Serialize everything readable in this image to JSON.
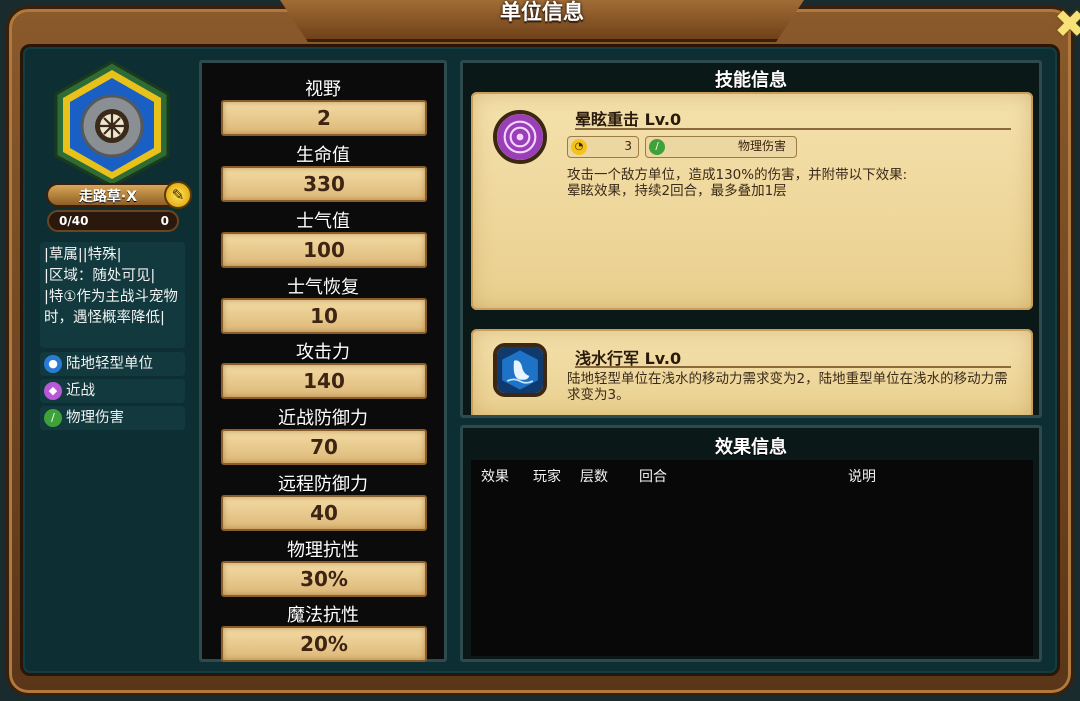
{
  "window": {
    "title": "单位信息"
  },
  "unit": {
    "name": "走路草·X",
    "exp": "0/40",
    "level": "0",
    "description": "|草属||特殊|\n|区域：随处可见|\n|特①作为主战斗宠物时，遇怪概率降低|",
    "tags": [
      {
        "icon": "person-icon",
        "label": "陆地轻型单位",
        "color": "#2a7bd6"
      },
      {
        "icon": "melee-icon",
        "label": "近战",
        "color": "#b85ad8"
      },
      {
        "icon": "sword-icon",
        "label": "物理伤害",
        "color": "#3fa13a"
      }
    ]
  },
  "stats": [
    {
      "label": "视野",
      "value": "2"
    },
    {
      "label": "生命值",
      "value": "330"
    },
    {
      "label": "士气值",
      "value": "100"
    },
    {
      "label": "士气恢复",
      "value": "10"
    },
    {
      "label": "攻击力",
      "value": "140"
    },
    {
      "label": "近战防御力",
      "value": "70"
    },
    {
      "label": "远程防御力",
      "value": "40"
    },
    {
      "label": "物理抗性",
      "value": "30%"
    },
    {
      "label": "魔法抗性",
      "value": "20%"
    }
  ],
  "skills_panel": {
    "title": "技能信息",
    "skills": [
      {
        "name": "晕眩重击 Lv.0",
        "cooldown": "3",
        "damage_type": "物理伤害",
        "description": "攻击一个敌方单位，造成130%的伤害，并附带以下效果:\n晕眩效果，持续2回合，最多叠加1层",
        "icon": "stun-swirl-icon"
      },
      {
        "name": "浅水行军 Lv.0",
        "description": "陆地轻型单位在浅水的移动力需求变为2，陆地重型单位在浅水的移动力需求变为3。",
        "icon": "water-foot-icon"
      }
    ]
  },
  "effects_panel": {
    "title": "效果信息",
    "columns": [
      "效果",
      "玩家",
      "层数",
      "回合",
      "说明"
    ]
  }
}
